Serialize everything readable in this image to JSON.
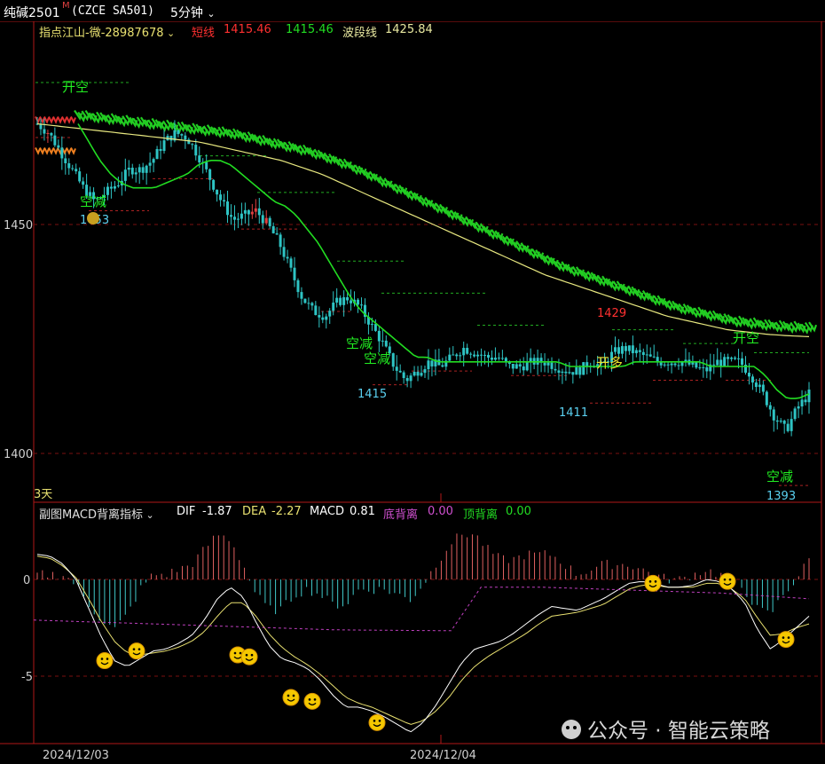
{
  "header": {
    "symbol": "纯碱2501",
    "symbol_flag": "M",
    "code": "(CZCE  SA501)",
    "period": "5分钟"
  },
  "main_legend": {
    "indicator": "指点江山-微-28987678",
    "short_label": "短线",
    "short_value": "1415.46",
    "mid_value": "1415.46",
    "wave_label": "波段线",
    "wave_value": "1425.84"
  },
  "sub_legend": {
    "indicator": "副图MACD背离指标",
    "dif_label": "DIF",
    "dif_value": "-1.87",
    "dea_label": "DEA",
    "dea_value": "-2.27",
    "macd_label": "MACD",
    "macd_value": "0.81",
    "bottom_div_label": "底背离",
    "bottom_div_value": "0.00",
    "top_div_label": "顶背离",
    "top_div_value": "0.00"
  },
  "days_label": "3天",
  "watermark": "公众号 · 智能云策略",
  "colors": {
    "candle": "#2ec4c4",
    "candle_up_red": "#e04040",
    "short_line": "#22dd22",
    "wave_line": "#e8e880",
    "green_band": "#22cc22",
    "macd_pos": "#e06060",
    "macd_neg": "#40c8c8",
    "dif": "#ffffff",
    "dea": "#e8e070",
    "div_line": "#c040c0",
    "frame": "#b01818",
    "grid": "#7a1010"
  },
  "chart_data": [
    {
      "type": "candlestick",
      "title": "纯碱2501 (CZCE SA501) 5分钟",
      "y_axis_ticks": [
        1450,
        1400
      ],
      "ylim": [
        1388,
        1484
      ],
      "x_axis_labels": [
        "2024/12/03",
        "2024/12/04"
      ],
      "price_path": [
        1472,
        1470,
        1466,
        1462,
        1458,
        1455,
        1457,
        1459,
        1462,
        1462,
        1464,
        1468,
        1470,
        1469,
        1465,
        1460,
        1455,
        1451,
        1452,
        1453,
        1450,
        1446,
        1440,
        1434,
        1431,
        1430,
        1433,
        1434,
        1432,
        1428,
        1424,
        1419,
        1416,
        1418,
        1420,
        1419,
        1421,
        1423,
        1422,
        1421,
        1421,
        1419,
        1419,
        1420,
        1420,
        1419,
        1418,
        1418,
        1420,
        1419,
        1422,
        1423,
        1422,
        1421,
        1420,
        1420,
        1420,
        1419,
        1418,
        1420,
        1420,
        1420,
        1417,
        1413,
        1408,
        1405,
        1410,
        1413
      ],
      "short_line_path": [
        1472,
        1468,
        1464,
        1461,
        1459,
        1458,
        1458,
        1458,
        1459,
        1460,
        1461,
        1463,
        1464,
        1464,
        1463,
        1461,
        1459,
        1457,
        1455,
        1454,
        1452,
        1449,
        1446,
        1442,
        1438,
        1434,
        1431,
        1429,
        1427,
        1425,
        1423,
        1421,
        1421,
        1420,
        1420,
        1420,
        1420,
        1420,
        1420,
        1420,
        1420,
        1420,
        1420,
        1420,
        1420,
        1419,
        1419,
        1419,
        1419,
        1419,
        1419,
        1420,
        1420,
        1420,
        1420,
        1420,
        1420,
        1420,
        1419,
        1419,
        1419,
        1419,
        1419,
        1417,
        1414,
        1412,
        1412,
        1413
      ],
      "wave_line_path": [
        1472,
        1471.5,
        1471,
        1470.5,
        1470,
        1469.5,
        1469,
        1468.5,
        1468,
        1467,
        1466,
        1465,
        1464,
        1462.5,
        1461,
        1459,
        1457,
        1455,
        1453,
        1451,
        1449,
        1447,
        1445,
        1443,
        1441,
        1439,
        1437.5,
        1436,
        1434.5,
        1433,
        1431.5,
        1430,
        1429,
        1428,
        1427,
        1426.5,
        1426,
        1425.7,
        1425.5
      ],
      "annotations": [
        {
          "text": "开空",
          "kind": "signal",
          "price": 1475
        },
        {
          "text": "空减",
          "kind": "signal",
          "price": 1455
        },
        {
          "text": "1453",
          "kind": "low_label",
          "price": 1453
        },
        {
          "text": "空减",
          "kind": "signal",
          "price": 1423
        },
        {
          "text": "空减",
          "kind": "signal",
          "price": 1420
        },
        {
          "text": "1415",
          "kind": "low_label",
          "price": 1415
        },
        {
          "text": "1411",
          "kind": "low_label",
          "price": 1411
        },
        {
          "text": "1429",
          "kind": "high_label",
          "price": 1429
        },
        {
          "text": "开多",
          "kind": "signal",
          "price": 1419
        },
        {
          "text": "开空",
          "kind": "signal",
          "price": 1423
        },
        {
          "text": "空减",
          "kind": "signal",
          "price": 1396
        },
        {
          "text": "1393",
          "kind": "low_label",
          "price": 1393
        }
      ]
    },
    {
      "type": "bar",
      "title": "副图MACD背离指标",
      "y_axis_ticks": [
        0,
        -5
      ],
      "ylim": [
        -8.1,
        2.6
      ],
      "dif_path": [
        1.3,
        1.2,
        0.8,
        0,
        -1.5,
        -3,
        -4.2,
        -4.5,
        -4.1,
        -3.7,
        -3.6,
        -3.3,
        -2.9,
        -2.1,
        -1,
        -0.4,
        -0.9,
        -2.2,
        -3.4,
        -4.1,
        -4.3,
        -4.6,
        -5.2,
        -6,
        -6.6,
        -6.6,
        -6.8,
        -7.1,
        -7.5,
        -7.9,
        -7.4,
        -6.5,
        -5.4,
        -4.3,
        -3.6,
        -3.4,
        -3.2,
        -2.8,
        -2.3,
        -1.8,
        -1.4,
        -1.5,
        -1.6,
        -1.3,
        -1,
        -0.6,
        -0.2,
        -0.1,
        -0.2,
        -0.4,
        -0.4,
        -0.3,
        0,
        -0.1,
        -0.5,
        -1.2,
        -2.6,
        -3.6,
        -3.1,
        -2.5,
        -1.9
      ],
      "dea_path": [
        1.2,
        1.1,
        0.7,
        0.1,
        -1,
        -2.2,
        -3.2,
        -3.8,
        -3.9,
        -3.8,
        -3.7,
        -3.5,
        -3.2,
        -2.7,
        -1.9,
        -1.2,
        -1.2,
        -1.9,
        -2.8,
        -3.5,
        -4,
        -4.4,
        -4.9,
        -5.5,
        -6.1,
        -6.4,
        -6.6,
        -6.9,
        -7.2,
        -7.5,
        -7.3,
        -6.8,
        -6.1,
        -5.2,
        -4.5,
        -4,
        -3.6,
        -3.2,
        -2.8,
        -2.3,
        -1.9,
        -1.8,
        -1.7,
        -1.5,
        -1.3,
        -0.9,
        -0.5,
        -0.3,
        -0.3,
        -0.4,
        -0.4,
        -0.4,
        -0.2,
        -0.2,
        -0.5,
        -1,
        -2,
        -2.9,
        -2.8,
        -2.5,
        -2.3
      ],
      "divergence_level_path": [
        -2.1,
        -2.15,
        -2.2,
        -2.25,
        -2.3,
        -2.35,
        -2.4,
        -2.45,
        -2.5,
        -2.55,
        -2.6,
        -2.62,
        -2.63,
        -2.64,
        -2.65,
        -0.4,
        -0.4,
        -0.4,
        -0.45,
        -0.5,
        -0.55,
        -0.6,
        -0.65,
        -0.7,
        -0.8,
        -0.9,
        -1
      ],
      "smiley_markers": [
        -4.2,
        -3.7,
        -3.9,
        -4.0,
        -6.1,
        -6.3,
        -7.4,
        -0.2,
        -0.1,
        -3.1
      ]
    }
  ]
}
